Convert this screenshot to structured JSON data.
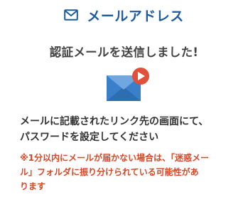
{
  "header": {
    "icon": "envelope-outline-icon",
    "title": "メールアドレス",
    "accent_color": "#1f5a9e"
  },
  "subtitle": "認証メールを送信しました!",
  "illustration": {
    "icon": "email-sent-icon",
    "envelope_color": "#3a7fc9",
    "badge_color": "#e0503a"
  },
  "instruction": {
    "lines": [
      "メールに記載されたリンク先の画面にて、",
      "パスワードを設定してください"
    ]
  },
  "note": {
    "color": "#d44a28",
    "lines": [
      "※1分以内にメールが届かない場合は、「迷惑メー",
      "ル」フォルダに振り分けられている可能性があ",
      "ります"
    ]
  }
}
